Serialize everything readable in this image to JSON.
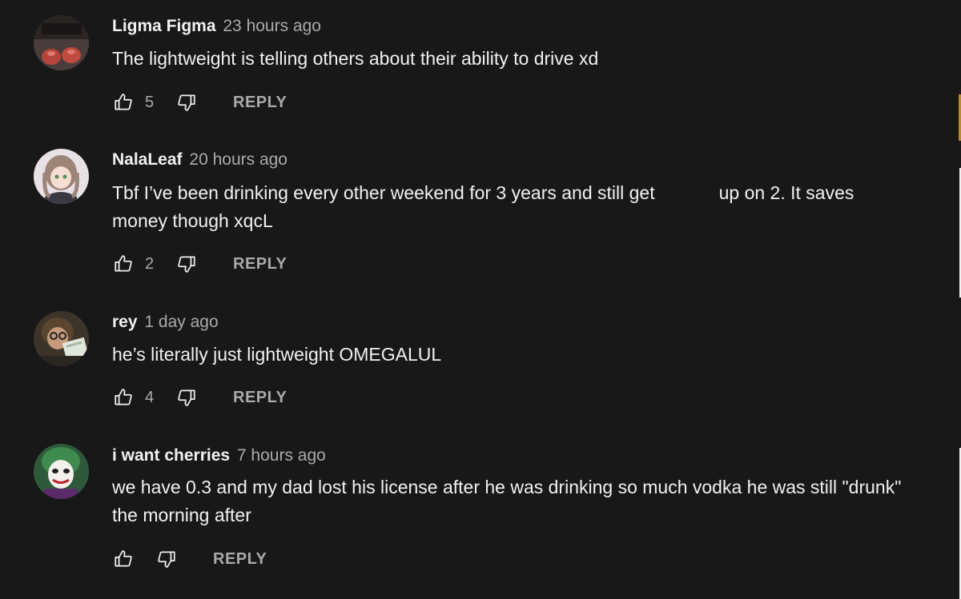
{
  "comments": [
    {
      "author": "Ligma Figma",
      "time": "23 hours ago",
      "text": "The lightweight is telling others about their ability to drive xd",
      "likes": "5",
      "reply_label": "REPLY",
      "avatar_icon": "boxing-gloves-avatar"
    },
    {
      "author": "NalaLeaf",
      "time": "20 hours ago",
      "text_part1": "Tbf I’ve been drinking every other weekend for 3 years and still get",
      "text_part2": "up on 2. It saves money though xqcL",
      "likes": "2",
      "reply_label": "REPLY",
      "avatar_icon": "anime-girl-avatar"
    },
    {
      "author": "rey",
      "time": "1 day ago",
      "text": "he’s literally just lightweight OMEGALUL",
      "likes": "4",
      "reply_label": "REPLY",
      "avatar_icon": "person-with-cash-avatar"
    },
    {
      "author": "i want cherries",
      "time": "7 hours ago",
      "text": "we have 0.3 and my dad lost his license after he was drinking so much vodka he was still \"drunk\" the morning after",
      "likes": "",
      "reply_label": "REPLY",
      "avatar_icon": "joker-avatar"
    }
  ],
  "colors": {
    "background": "#181818",
    "primary_text": "#f1f1f1",
    "secondary_text": "#aaaaaa"
  },
  "icons": {
    "like": "thumbs-up-icon",
    "dislike": "thumbs-down-icon"
  }
}
